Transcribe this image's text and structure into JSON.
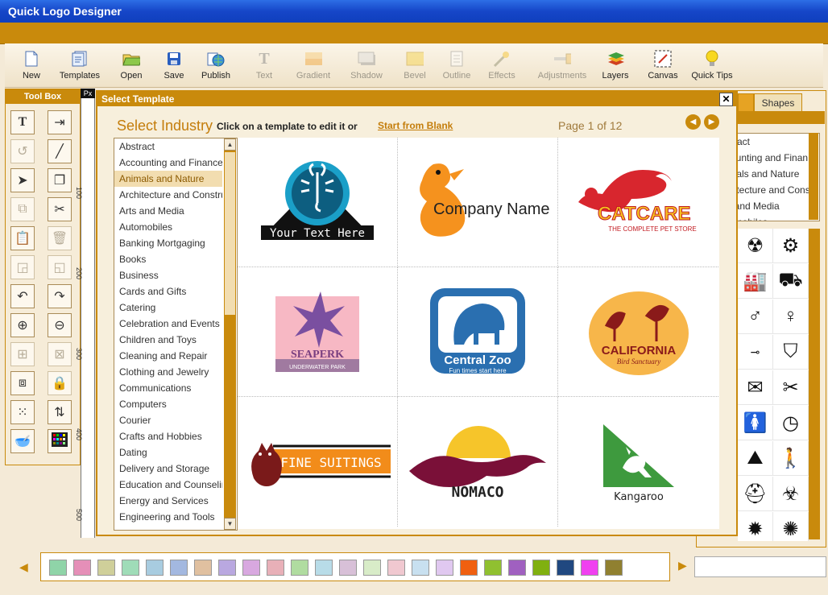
{
  "window": {
    "title": "Quick Logo Designer"
  },
  "toolbar": [
    {
      "label": "New",
      "icon": "new-file-icon",
      "enabled": true
    },
    {
      "label": "Templates",
      "icon": "templates-icon",
      "enabled": true
    },
    {
      "label": "Open",
      "icon": "open-folder-icon",
      "enabled": true
    },
    {
      "label": "Save",
      "icon": "save-disk-icon",
      "enabled": true
    },
    {
      "label": "Publish",
      "icon": "publish-globe-icon",
      "enabled": true
    },
    {
      "label": "Text",
      "icon": "text-icon",
      "enabled": false
    },
    {
      "label": "Gradient",
      "icon": "gradient-icon",
      "enabled": false
    },
    {
      "label": "Shadow",
      "icon": "shadow-icon",
      "enabled": false
    },
    {
      "label": "Bevel",
      "icon": "bevel-icon",
      "enabled": false
    },
    {
      "label": "Outline",
      "icon": "outline-icon",
      "enabled": false
    },
    {
      "label": "Effects",
      "icon": "effects-wand-icon",
      "enabled": false
    },
    {
      "label": "Adjustments",
      "icon": "adjustments-slider-icon",
      "enabled": false
    },
    {
      "label": "Layers",
      "icon": "layers-icon",
      "enabled": true
    },
    {
      "label": "Canvas",
      "icon": "canvas-icon",
      "enabled": true
    },
    {
      "label": "Quick Tips",
      "icon": "lightbulb-icon",
      "enabled": true
    }
  ],
  "toolbox": {
    "title": "Tool Box",
    "text_tool": "T"
  },
  "ruler": {
    "unit": "Px",
    "marks": [
      "100",
      "200",
      "300",
      "400",
      "500"
    ]
  },
  "right_panel": {
    "tab_label": "Shapes",
    "industries_partial": [
      "Abstract",
      "Accounting and Finan",
      "Animals and Nature",
      "Architecture and Cons",
      "Arts and Media",
      "Automobiles"
    ]
  },
  "dialog": {
    "title": "Select Template",
    "close_label": "✕",
    "heading": "Select Industry",
    "hint": "Click on a template to edit it or",
    "start_blank": "Start from Blank",
    "page_info": "Page 1 of 12",
    "industries": [
      "Abstract",
      "Accounting and Finance",
      "Animals and Nature",
      "Architecture and Construction",
      "Arts and Media",
      "Automobiles",
      "Banking Mortgaging",
      "Books",
      "Business",
      "Cards and Gifts",
      "Catering",
      "Celebration and Events",
      "Children and Toys",
      "Cleaning and Repair",
      "Clothing and Jewelry",
      "Communications",
      "Computers",
      "Courier",
      "Crafts and Hobbies",
      "Dating",
      "Delivery and Storage",
      "Education and Counseling",
      "Energy and Services",
      "Engineering and Tools"
    ],
    "selected_industry": "Animals and Nature",
    "templates": [
      {
        "name": "scorpion",
        "text": "Your Text Here"
      },
      {
        "name": "penguin",
        "text": "Company Name"
      },
      {
        "name": "catcare",
        "text": "CATCARE",
        "subtext": "THE COMPLETE PET STORE"
      },
      {
        "name": "seaperk",
        "text": "SEAPERK",
        "subtext": "UNDERWATER PARK"
      },
      {
        "name": "central-zoo",
        "text": "Central Zoo",
        "subtext": "Fun times start here"
      },
      {
        "name": "california",
        "text": "CALIFORNIA",
        "subtext": "Bird Sanctuary"
      },
      {
        "name": "fine-suitings",
        "text": "FINE SUITINGS"
      },
      {
        "name": "nomaco",
        "text": "NOMACO"
      },
      {
        "name": "kangaroo",
        "text": "Kangaroo"
      }
    ]
  },
  "palette": {
    "colors": [
      "#8fd4a8",
      "#e58fb8",
      "#cfcf9a",
      "#9fdcb8",
      "#a8cce0",
      "#a3b8e0",
      "#e0c0a0",
      "#b9a8e0",
      "#d8a8e0",
      "#e8b0b8",
      "#b0dca0",
      "#b8dce8",
      "#d8c0d8",
      "#d8ecc8",
      "#f0c8d0",
      "#c8e0f0",
      "#e0c8f0",
      "#f06010",
      "#90c030",
      "#a060c0",
      "#80b010",
      "#204880",
      "#f040f0",
      "#908030"
    ]
  },
  "colors": {
    "accent": "#c98a0c",
    "titlebar": "#1646c8",
    "link": "#c47d0b"
  }
}
